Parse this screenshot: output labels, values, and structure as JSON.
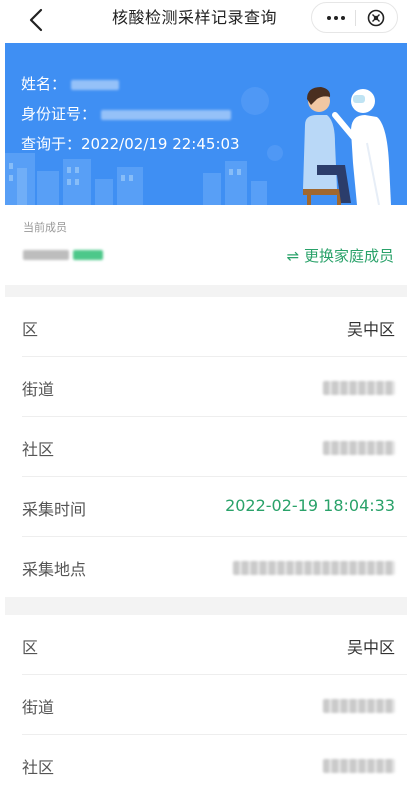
{
  "nav": {
    "title": "核酸检测采样记录查询",
    "back_icon": "chevron-left-icon",
    "more_icon": "more-dots-icon",
    "close_icon": "close-circle-icon"
  },
  "banner": {
    "name_label": "姓名：",
    "id_label": "身份证号：",
    "query_time": "查询于：2022/02/19 22:45:03",
    "bg_color": "#3f8ff3"
  },
  "member": {
    "label": "当前成员",
    "switch_label": "⇌ 更换家庭成员",
    "accent": "#2aa26a"
  },
  "records": [
    {
      "fields": [
        {
          "key": "区",
          "value": "吴中区"
        },
        {
          "key": "街道",
          "value": ""
        },
        {
          "key": "社区",
          "value": ""
        },
        {
          "key": "采集时间",
          "value": "2022-02-19 18:04:33"
        },
        {
          "key": "采集地点",
          "value": ""
        }
      ]
    },
    {
      "fields": [
        {
          "key": "区",
          "value": "吴中区"
        },
        {
          "key": "街道",
          "value": ""
        },
        {
          "key": "社区",
          "value": ""
        }
      ]
    }
  ]
}
